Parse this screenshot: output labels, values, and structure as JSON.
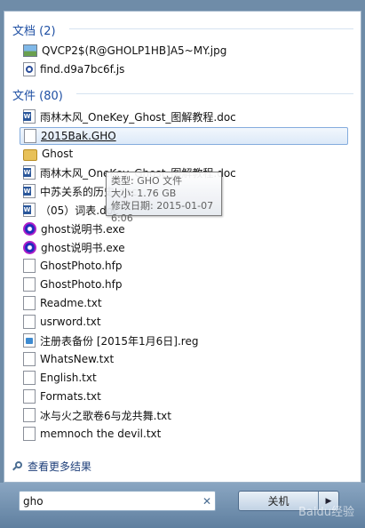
{
  "documents_group": {
    "header": "文档 (2)",
    "items": [
      {
        "label": "QVCP2$(R@GHOLP1HB]A5~MY.jpg",
        "icon": "jpg-file-icon"
      },
      {
        "label": "find.d9a7bc6f.js",
        "icon": "js-file-icon"
      }
    ]
  },
  "files_group": {
    "header": "文件 (80)",
    "items": [
      {
        "label": "雨林木风_OneKey_Ghost_图解教程.doc",
        "icon": "doc-file-icon"
      },
      {
        "label": "2015Bak.GHO",
        "icon": "blank-file-icon",
        "selected": true
      },
      {
        "label": "Ghost",
        "icon": "folder-icon"
      },
      {
        "label": "雨林木风_OneKey_Ghost_图解教程.doc",
        "icon": "doc-file-icon"
      },
      {
        "label": "中苏关系的历史.doc",
        "icon": "doc-file-icon"
      },
      {
        "label": "（05）词表.doc",
        "icon": "doc-file-icon"
      },
      {
        "label": "ghost说明书.exe",
        "icon": "exe-file-icon"
      },
      {
        "label": "ghost说明书.exe",
        "icon": "exe-file-icon"
      },
      {
        "label": "GhostPhoto.hfp",
        "icon": "blank-file-icon"
      },
      {
        "label": "GhostPhoto.hfp",
        "icon": "blank-file-icon"
      },
      {
        "label": "Readme.txt",
        "icon": "text-file-icon"
      },
      {
        "label": "usrword.txt",
        "icon": "text-file-icon"
      },
      {
        "label": "注册表备份 [2015年1月6日].reg",
        "icon": "reg-file-icon"
      },
      {
        "label": "WhatsNew.txt",
        "icon": "text-file-icon"
      },
      {
        "label": "English.txt",
        "icon": "text-file-icon"
      },
      {
        "label": "Formats.txt",
        "icon": "text-file-icon"
      },
      {
        "label": "冰与火之歌卷6与龙共舞.txt",
        "icon": "text-file-icon"
      },
      {
        "label": "memnoch the devil.txt",
        "icon": "text-file-icon"
      }
    ]
  },
  "tooltip": {
    "type_line": "类型: GHO 文件",
    "size_line": "大小: 1.76 GB",
    "date_line": "修改日期: 2015-01-07 6:06"
  },
  "see_more": "查看更多结果",
  "search": {
    "value": "gho",
    "clear_icon": "clear-icon"
  },
  "shutdown": {
    "label": "关机"
  },
  "watermark": "Baidu经验",
  "colors": {
    "header": "#1e4fa3",
    "selection_border": "#84acdd",
    "taskbar": "#6f8ca8"
  }
}
